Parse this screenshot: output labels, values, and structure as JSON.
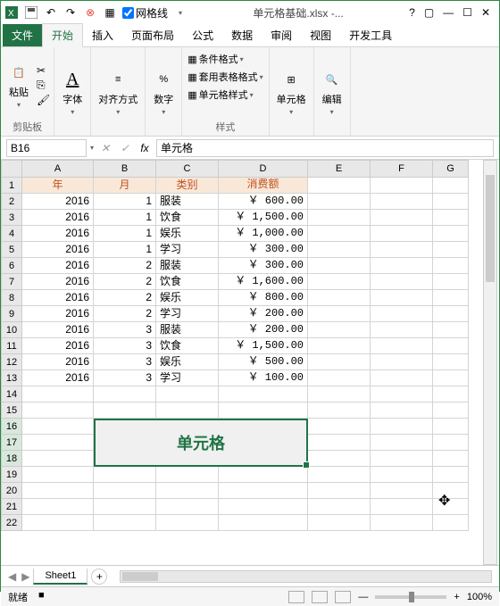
{
  "title": "单元格基础.xlsx -...",
  "qat_gridlines_label": "网格线",
  "tabs": {
    "file": "文件",
    "home": "开始",
    "insert": "插入",
    "pagelayout": "页面布局",
    "formulas": "公式",
    "data": "数据",
    "review": "审阅",
    "view": "视图",
    "developer": "开发工具"
  },
  "ribbon": {
    "clipboard": {
      "paste": "粘贴",
      "label": "剪贴板"
    },
    "font": {
      "btn": "字体",
      "label": ""
    },
    "align": {
      "btn": "对齐方式",
      "label": ""
    },
    "number": {
      "btn": "数字",
      "label": ""
    },
    "styles": {
      "cond": "条件格式",
      "table": "套用表格格式",
      "cell": "单元格样式",
      "label": "样式"
    },
    "cells": {
      "btn": "单元格",
      "label": ""
    },
    "editing": {
      "btn": "编辑",
      "label": ""
    }
  },
  "name_box": "B16",
  "formula": "单元格",
  "columns": [
    "A",
    "B",
    "C",
    "D",
    "E",
    "F",
    "G"
  ],
  "row_count": 22,
  "selected_rows": [
    16,
    17,
    18
  ],
  "chart_data": {
    "type": "table",
    "headers": [
      "年",
      "月",
      "类别",
      "消费额"
    ],
    "rows": [
      [
        "2016",
        "1",
        "服装",
        "￥   600.00"
      ],
      [
        "2016",
        "1",
        "饮食",
        "￥ 1,500.00"
      ],
      [
        "2016",
        "1",
        "娱乐",
        "￥ 1,000.00"
      ],
      [
        "2016",
        "1",
        "学习",
        "￥   300.00"
      ],
      [
        "2016",
        "2",
        "服装",
        "￥   300.00"
      ],
      [
        "2016",
        "2",
        "饮食",
        "￥ 1,600.00"
      ],
      [
        "2016",
        "2",
        "娱乐",
        "￥   800.00"
      ],
      [
        "2016",
        "2",
        "学习",
        "￥   200.00"
      ],
      [
        "2016",
        "3",
        "服装",
        "￥   200.00"
      ],
      [
        "2016",
        "3",
        "饮食",
        "￥ 1,500.00"
      ],
      [
        "2016",
        "3",
        "娱乐",
        "￥   500.00"
      ],
      [
        "2016",
        "3",
        "学习",
        "￥   100.00"
      ]
    ]
  },
  "merged_text": "单元格",
  "sheet_tabs": {
    "active": "Sheet1"
  },
  "status": {
    "ready": "就绪",
    "rec": "■"
  },
  "zoom": "100%"
}
